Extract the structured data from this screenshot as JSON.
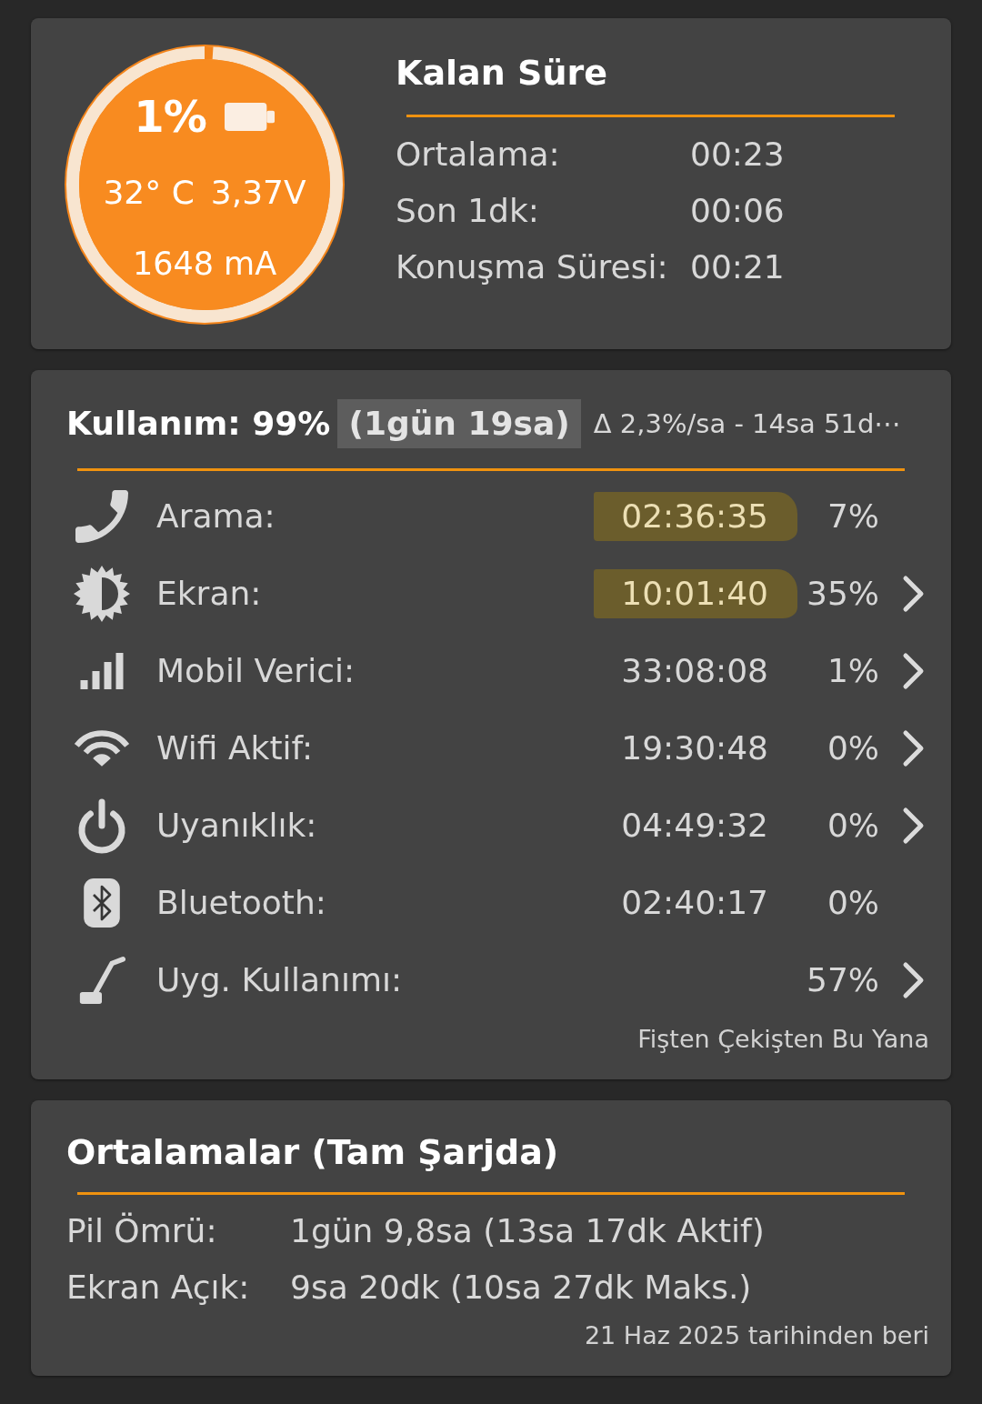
{
  "battery": {
    "percent": "1%",
    "level": 0.01,
    "temperature": "32° C",
    "voltage": "3,37V",
    "current": "1648 mA"
  },
  "remaining": {
    "title": "Kalan Süre",
    "rows": [
      {
        "label": "Ortalama:",
        "value": "00:23"
      },
      {
        "label": "Son 1dk:",
        "value": "00:06"
      },
      {
        "label": "Konuşma Süresi:",
        "value": "00:21"
      }
    ]
  },
  "usage": {
    "title": "Kullanım: 99%",
    "estimate": "(1gün 19sa)",
    "estimate_highlighted": true,
    "rate": "Δ 2,3%/sa - 14sa 51d⋯",
    "rows": [
      {
        "label": "Arama:",
        "time": "02:36:35",
        "percent": "7%",
        "highlighted": true,
        "chevron": false
      },
      {
        "label": "Ekran:",
        "time": "10:01:40",
        "percent": "35%",
        "highlighted": true,
        "chevron": true
      },
      {
        "label": "Mobil Verici:",
        "time": "33:08:08",
        "percent": "1%",
        "highlighted": false,
        "chevron": true
      },
      {
        "label": "Wifi Aktif:",
        "time": "19:30:48",
        "percent": "0%",
        "highlighted": false,
        "chevron": true
      },
      {
        "label": "Uyanıklık:",
        "time": "04:49:32",
        "percent": "0%",
        "highlighted": false,
        "chevron": true
      },
      {
        "label": "Bluetooth:",
        "time": "02:40:17",
        "percent": "0%",
        "highlighted": false,
        "chevron": false
      },
      {
        "label": "Uyg. Kullanımı:",
        "percent": "57%",
        "highlighted": false,
        "chevron": true
      }
    ],
    "footer": "Fişten Çekişten Bu Yana"
  },
  "averages": {
    "title": "Ortalamalar (Tam Şarjda)",
    "rows": [
      {
        "label": "Pil Ömrü:",
        "value": "1gün 9,8sa (13sa 17dk Aktif)"
      },
      {
        "label": "Ekran Açık:",
        "value": "9sa 20dk (10sa 27dk Maks.)"
      }
    ],
    "footer": "21 Haz 2025 tarihinden beri"
  }
}
